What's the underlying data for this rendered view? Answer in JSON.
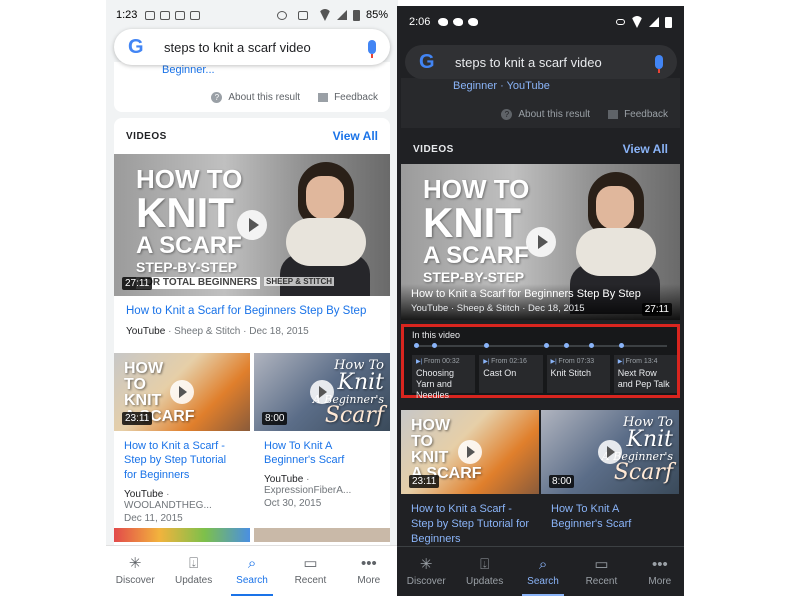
{
  "light": {
    "status": {
      "time": "1:23",
      "battery": "85%"
    },
    "search": {
      "query": "steps to knit a scarf video"
    },
    "top_card": {
      "beginner_text": "Beginner...",
      "about": "About this result",
      "feedback": "Feedback"
    },
    "videos": {
      "header": "VIDEOS",
      "view_all": "View All",
      "main": {
        "thumb_lines": [
          "HOW TO",
          "KNIT",
          "A SCARF",
          "STEP-BY-STEP",
          "FOR TOTAL BEGINNERS"
        ],
        "brand": "SHEEP & STITCH",
        "duration": "27:11",
        "title": "How to Knit a Scarf for Beginners Step By Step",
        "source": "YouTube",
        "meta": "· Sheep & Stitch · Dec 18, 2015"
      },
      "left": {
        "thumb_lines": [
          "HOW",
          "TO",
          "KNIT",
          "A SCARF"
        ],
        "duration": "23:11",
        "title": "How to Knit a Scarf - Step by Step Tutorial for Beginners",
        "source": "YouTube",
        "meta": "· WOOLANDTHEG...",
        "date": "Dec 11, 2015"
      },
      "right": {
        "thumb_lines": [
          "How To",
          "Knit",
          "A Beginner's",
          "Scarf"
        ],
        "duration": "8:00",
        "title": "How To Knit A Beginner's Scarf",
        "source": "YouTube",
        "meta": "· ExpressionFiberA...",
        "date": "Oct 30, 2015"
      }
    },
    "nav": [
      {
        "label": "Discover",
        "icon": "✳"
      },
      {
        "label": "Updates",
        "icon": "⍗"
      },
      {
        "label": "Search",
        "icon": "⌕"
      },
      {
        "label": "Recent",
        "icon": "▭"
      },
      {
        "label": "More",
        "icon": "•••"
      }
    ]
  },
  "dark": {
    "status": {
      "time": "2:06"
    },
    "search": {
      "query": "steps to knit a scarf video"
    },
    "top_card": {
      "beginner_text": "Beginner · YouTube",
      "about": "About this result",
      "feedback": "Feedback"
    },
    "videos": {
      "header": "VIDEOS",
      "view_all": "View All",
      "main": {
        "thumb_lines": [
          "HOW TO",
          "KNIT",
          "A SCARF",
          "STEP-BY-STEP"
        ],
        "title": "How to Knit a Scarf for Beginners Step By Step",
        "meta": "YouTube · Sheep & Stitch · Dec 18, 2015",
        "duration": "27:11"
      },
      "in_this_video": {
        "label": "In this video",
        "chapters": [
          {
            "from": "From 00:32",
            "title": "Choosing Yarn and Needles"
          },
          {
            "from": "From 02:16",
            "title": "Cast On"
          },
          {
            "from": "From 07:33",
            "title": "Knit Stitch"
          },
          {
            "from": "From 13:4",
            "title": "Next Row and Pep Talk"
          }
        ]
      },
      "left": {
        "thumb_lines": [
          "HOW",
          "TO",
          "KNIT",
          "A SCARF"
        ],
        "duration": "23:11",
        "title": "How to Knit a Scarf - Step by Step Tutorial for Beginners"
      },
      "right": {
        "thumb_lines": [
          "How To",
          "Knit",
          "A Beginner's",
          "Scarf"
        ],
        "duration": "8:00",
        "title": "How To Knit A Beginner's Scarf"
      }
    },
    "nav": [
      {
        "label": "Discover",
        "icon": "✳"
      },
      {
        "label": "Updates",
        "icon": "⍗"
      },
      {
        "label": "Search",
        "icon": "⌕"
      },
      {
        "label": "Recent",
        "icon": "▭"
      },
      {
        "label": "More",
        "icon": "•••"
      }
    ]
  },
  "colors": {
    "google_blue": "#4285f4",
    "link_blue": "#1a73e8",
    "dark_link_blue": "#8ab4f8",
    "highlight_red": "#d9251f",
    "dark_bg": "#202124"
  }
}
